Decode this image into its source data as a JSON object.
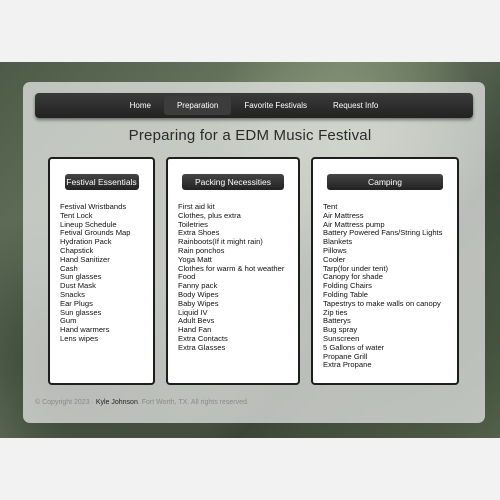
{
  "nav": [
    "Home",
    "Preparation",
    "Favorite Festivals",
    "Request Info"
  ],
  "page_title": "Preparing for a EDM Music Festival",
  "panels": [
    {
      "title": "Festival Essentials",
      "items": [
        "Festival Wristbands",
        "Tent Lock",
        "Lineup Schedule",
        "Fetival Grounds Map",
        "Hydration Pack",
        "Chapstick",
        "Hand Sanitizer",
        "Cash",
        "Sun glasses",
        "Dust Mask",
        "Snacks",
        "Ear Plugs",
        "Sun glasses",
        "Gum",
        "Hand warmers",
        "Lens wipes"
      ]
    },
    {
      "title": "Packing Necessities",
      "items": [
        "First aid kit",
        "Clothes, plus extra",
        "Toiletries",
        "Extra Shoes",
        "Rainboots(If it might rain)",
        "Rain ponchos",
        "Yoga Matt",
        "Clothes for warm & hot weather",
        "Food",
        "Fanny pack",
        "Body Wipes",
        "Baby Wipes",
        "Liquid IV",
        "Adult Bevs",
        "Hand Fan",
        "Extra Contacts",
        "Extra Glasses"
      ]
    },
    {
      "title": "Camping",
      "items": [
        "Tent",
        "Air Mattress",
        "Air Mattress pump",
        "Battery Powered Fans/String Lights",
        "Blankets",
        "Pillows",
        "Cooler",
        "Tarp(for under tent)",
        "Canopy for shade",
        "Folding Chairs",
        "Folding Table",
        "Tapestrys to make walls on canopy",
        "Zip ties",
        "Batterys",
        "Bug spray",
        "Sunscreen",
        "5 Gallons of water",
        "Propane Grill",
        "Extra Propane"
      ]
    }
  ],
  "footer": {
    "copyright": "© Copyright 2023 · ",
    "name": "Kyle Johnson",
    "rest": ". Fort Worth, TX. All rights reserved."
  }
}
